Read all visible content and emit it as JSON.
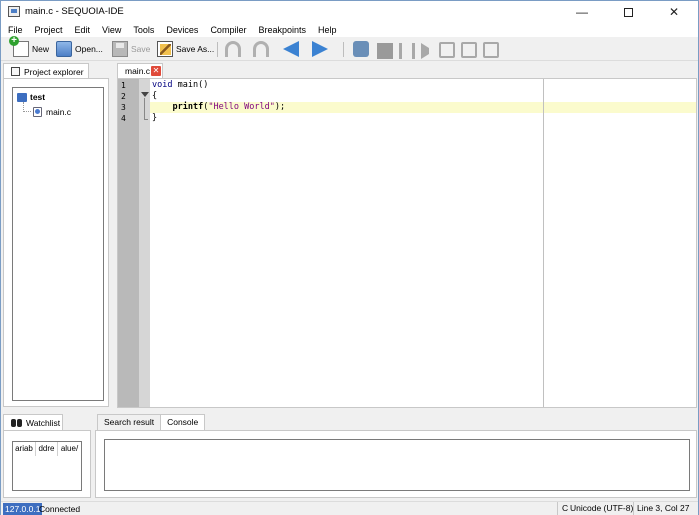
{
  "window": {
    "title": "main.c - SEQUOIA-IDE",
    "minimize_glyph": "—",
    "close_glyph": "✕"
  },
  "menu": [
    "File",
    "Project",
    "Edit",
    "View",
    "Tools",
    "Devices",
    "Compiler",
    "Breakpoints",
    "Help"
  ],
  "toolbar": {
    "new_label": "New",
    "open_label": "Open...",
    "save_label": "Save",
    "saveas_label": "Save As..."
  },
  "project_explorer": {
    "tab_label": "Project explorer",
    "project": "test",
    "files": [
      "main.c"
    ]
  },
  "editor": {
    "tab_label": "main.c",
    "close_glyph": "✕",
    "line_numbers": [
      "1",
      "2",
      "3",
      "4"
    ],
    "lines": [
      {
        "kw": "void",
        "rest": " main()"
      },
      {
        "text": "{"
      },
      {
        "indent": "    ",
        "fn": "printf",
        "open": "(",
        "str": "\"Hello World\"",
        "close": ");"
      },
      {
        "text": "}"
      }
    ],
    "current_line": 3
  },
  "watchlist": {
    "tab_label": "Watchlist",
    "columns": [
      "Variable",
      "Address",
      "Value"
    ],
    "columns_visible": [
      "ariab",
      "ddre",
      "/alue"
    ]
  },
  "bottom_tabs": {
    "search_label": "Search result",
    "console_label": "Console",
    "active": "Console"
  },
  "status": {
    "ip": "127.0.0.1",
    "connection": "Connected",
    "mode": "C",
    "encoding": "Unicode (UTF-8)",
    "cursor": "Line 3, Col 27"
  },
  "colors": {
    "accent": "#3d6ec0",
    "current_line": "#fbfbcd",
    "keyword": "#00007f",
    "string": "#7f007f"
  }
}
